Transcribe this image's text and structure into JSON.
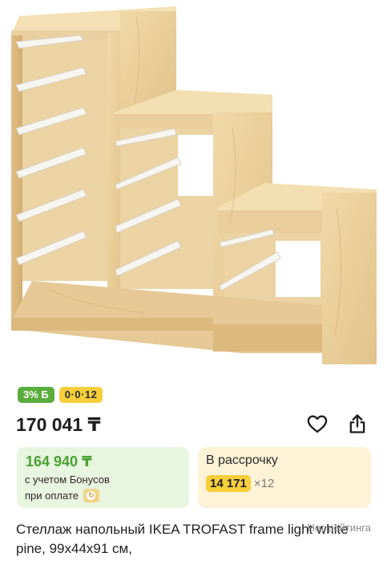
{
  "product": {
    "image_icon": "furniture-photo-icon",
    "badges": {
      "bonus": "3% Б",
      "installment": "0·0·12"
    },
    "price": "170 041 ₸",
    "bonus_card": {
      "amount": "164 940 ₸",
      "line1": "с учетом Бонусов",
      "line2": "при оплате"
    },
    "installment_card": {
      "title": "В рассрочку",
      "monthly": "14 171",
      "months": "×12"
    },
    "title": "Стеллаж напольный IKEA TROFAST frame light white pine, 99x44x91 см,",
    "rating": "Нет рейтинга"
  },
  "colors": {
    "accent_green": "#5aad3c",
    "accent_yellow": "#f7cf3a",
    "bonus_bg": "#e8f5df",
    "installment_bg": "#fdf3d6"
  }
}
